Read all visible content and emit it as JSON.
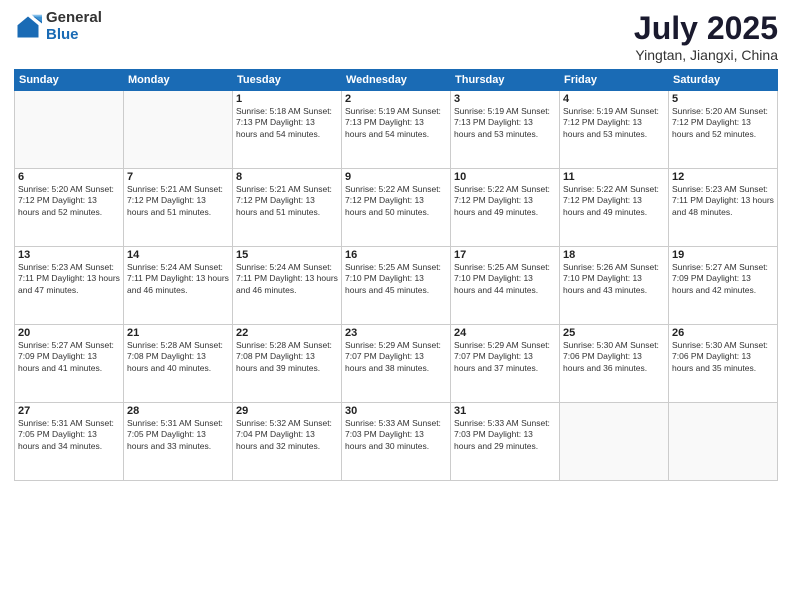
{
  "logo": {
    "general": "General",
    "blue": "Blue"
  },
  "header": {
    "title": "July 2025",
    "subtitle": "Yingtan, Jiangxi, China"
  },
  "days_of_week": [
    "Sunday",
    "Monday",
    "Tuesday",
    "Wednesday",
    "Thursday",
    "Friday",
    "Saturday"
  ],
  "weeks": [
    [
      {
        "day": "",
        "info": ""
      },
      {
        "day": "",
        "info": ""
      },
      {
        "day": "1",
        "info": "Sunrise: 5:18 AM\nSunset: 7:13 PM\nDaylight: 13 hours\nand 54 minutes."
      },
      {
        "day": "2",
        "info": "Sunrise: 5:19 AM\nSunset: 7:13 PM\nDaylight: 13 hours\nand 54 minutes."
      },
      {
        "day": "3",
        "info": "Sunrise: 5:19 AM\nSunset: 7:13 PM\nDaylight: 13 hours\nand 53 minutes."
      },
      {
        "day": "4",
        "info": "Sunrise: 5:19 AM\nSunset: 7:12 PM\nDaylight: 13 hours\nand 53 minutes."
      },
      {
        "day": "5",
        "info": "Sunrise: 5:20 AM\nSunset: 7:12 PM\nDaylight: 13 hours\nand 52 minutes."
      }
    ],
    [
      {
        "day": "6",
        "info": "Sunrise: 5:20 AM\nSunset: 7:12 PM\nDaylight: 13 hours\nand 52 minutes."
      },
      {
        "day": "7",
        "info": "Sunrise: 5:21 AM\nSunset: 7:12 PM\nDaylight: 13 hours\nand 51 minutes."
      },
      {
        "day": "8",
        "info": "Sunrise: 5:21 AM\nSunset: 7:12 PM\nDaylight: 13 hours\nand 51 minutes."
      },
      {
        "day": "9",
        "info": "Sunrise: 5:22 AM\nSunset: 7:12 PM\nDaylight: 13 hours\nand 50 minutes."
      },
      {
        "day": "10",
        "info": "Sunrise: 5:22 AM\nSunset: 7:12 PM\nDaylight: 13 hours\nand 49 minutes."
      },
      {
        "day": "11",
        "info": "Sunrise: 5:22 AM\nSunset: 7:12 PM\nDaylight: 13 hours\nand 49 minutes."
      },
      {
        "day": "12",
        "info": "Sunrise: 5:23 AM\nSunset: 7:11 PM\nDaylight: 13 hours\nand 48 minutes."
      }
    ],
    [
      {
        "day": "13",
        "info": "Sunrise: 5:23 AM\nSunset: 7:11 PM\nDaylight: 13 hours\nand 47 minutes."
      },
      {
        "day": "14",
        "info": "Sunrise: 5:24 AM\nSunset: 7:11 PM\nDaylight: 13 hours\nand 46 minutes."
      },
      {
        "day": "15",
        "info": "Sunrise: 5:24 AM\nSunset: 7:11 PM\nDaylight: 13 hours\nand 46 minutes."
      },
      {
        "day": "16",
        "info": "Sunrise: 5:25 AM\nSunset: 7:10 PM\nDaylight: 13 hours\nand 45 minutes."
      },
      {
        "day": "17",
        "info": "Sunrise: 5:25 AM\nSunset: 7:10 PM\nDaylight: 13 hours\nand 44 minutes."
      },
      {
        "day": "18",
        "info": "Sunrise: 5:26 AM\nSunset: 7:10 PM\nDaylight: 13 hours\nand 43 minutes."
      },
      {
        "day": "19",
        "info": "Sunrise: 5:27 AM\nSunset: 7:09 PM\nDaylight: 13 hours\nand 42 minutes."
      }
    ],
    [
      {
        "day": "20",
        "info": "Sunrise: 5:27 AM\nSunset: 7:09 PM\nDaylight: 13 hours\nand 41 minutes."
      },
      {
        "day": "21",
        "info": "Sunrise: 5:28 AM\nSunset: 7:08 PM\nDaylight: 13 hours\nand 40 minutes."
      },
      {
        "day": "22",
        "info": "Sunrise: 5:28 AM\nSunset: 7:08 PM\nDaylight: 13 hours\nand 39 minutes."
      },
      {
        "day": "23",
        "info": "Sunrise: 5:29 AM\nSunset: 7:07 PM\nDaylight: 13 hours\nand 38 minutes."
      },
      {
        "day": "24",
        "info": "Sunrise: 5:29 AM\nSunset: 7:07 PM\nDaylight: 13 hours\nand 37 minutes."
      },
      {
        "day": "25",
        "info": "Sunrise: 5:30 AM\nSunset: 7:06 PM\nDaylight: 13 hours\nand 36 minutes."
      },
      {
        "day": "26",
        "info": "Sunrise: 5:30 AM\nSunset: 7:06 PM\nDaylight: 13 hours\nand 35 minutes."
      }
    ],
    [
      {
        "day": "27",
        "info": "Sunrise: 5:31 AM\nSunset: 7:05 PM\nDaylight: 13 hours\nand 34 minutes."
      },
      {
        "day": "28",
        "info": "Sunrise: 5:31 AM\nSunset: 7:05 PM\nDaylight: 13 hours\nand 33 minutes."
      },
      {
        "day": "29",
        "info": "Sunrise: 5:32 AM\nSunset: 7:04 PM\nDaylight: 13 hours\nand 32 minutes."
      },
      {
        "day": "30",
        "info": "Sunrise: 5:33 AM\nSunset: 7:03 PM\nDaylight: 13 hours\nand 30 minutes."
      },
      {
        "day": "31",
        "info": "Sunrise: 5:33 AM\nSunset: 7:03 PM\nDaylight: 13 hours\nand 29 minutes."
      },
      {
        "day": "",
        "info": ""
      },
      {
        "day": "",
        "info": ""
      }
    ]
  ]
}
